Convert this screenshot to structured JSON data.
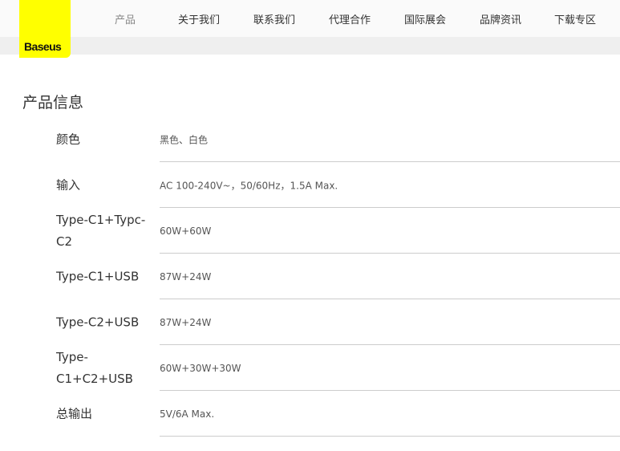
{
  "brand": "Baseus",
  "nav": [
    "产品",
    "关于我们",
    "联系我们",
    "代理合作",
    "国际展会",
    "品牌资讯",
    "下载专区"
  ],
  "section_title": "产品信息",
  "specs": [
    {
      "label": "颜色",
      "value": "黑色、白色"
    },
    {
      "label": "输入",
      "value": "AC 100-240V~，50/60Hz，1.5A Max."
    },
    {
      "label": "Type-C1+Typc-C2",
      "value": "60W+60W"
    },
    {
      "label": "Type-C1+USB",
      "value": "87W+24W"
    },
    {
      "label": "Type-C2+USB",
      "value": "87W+24W"
    },
    {
      "label": "Type-C1+C2+USB",
      "value": "60W+30W+30W"
    },
    {
      "label": "总输出",
      "value": "5V/6A Max."
    }
  ]
}
